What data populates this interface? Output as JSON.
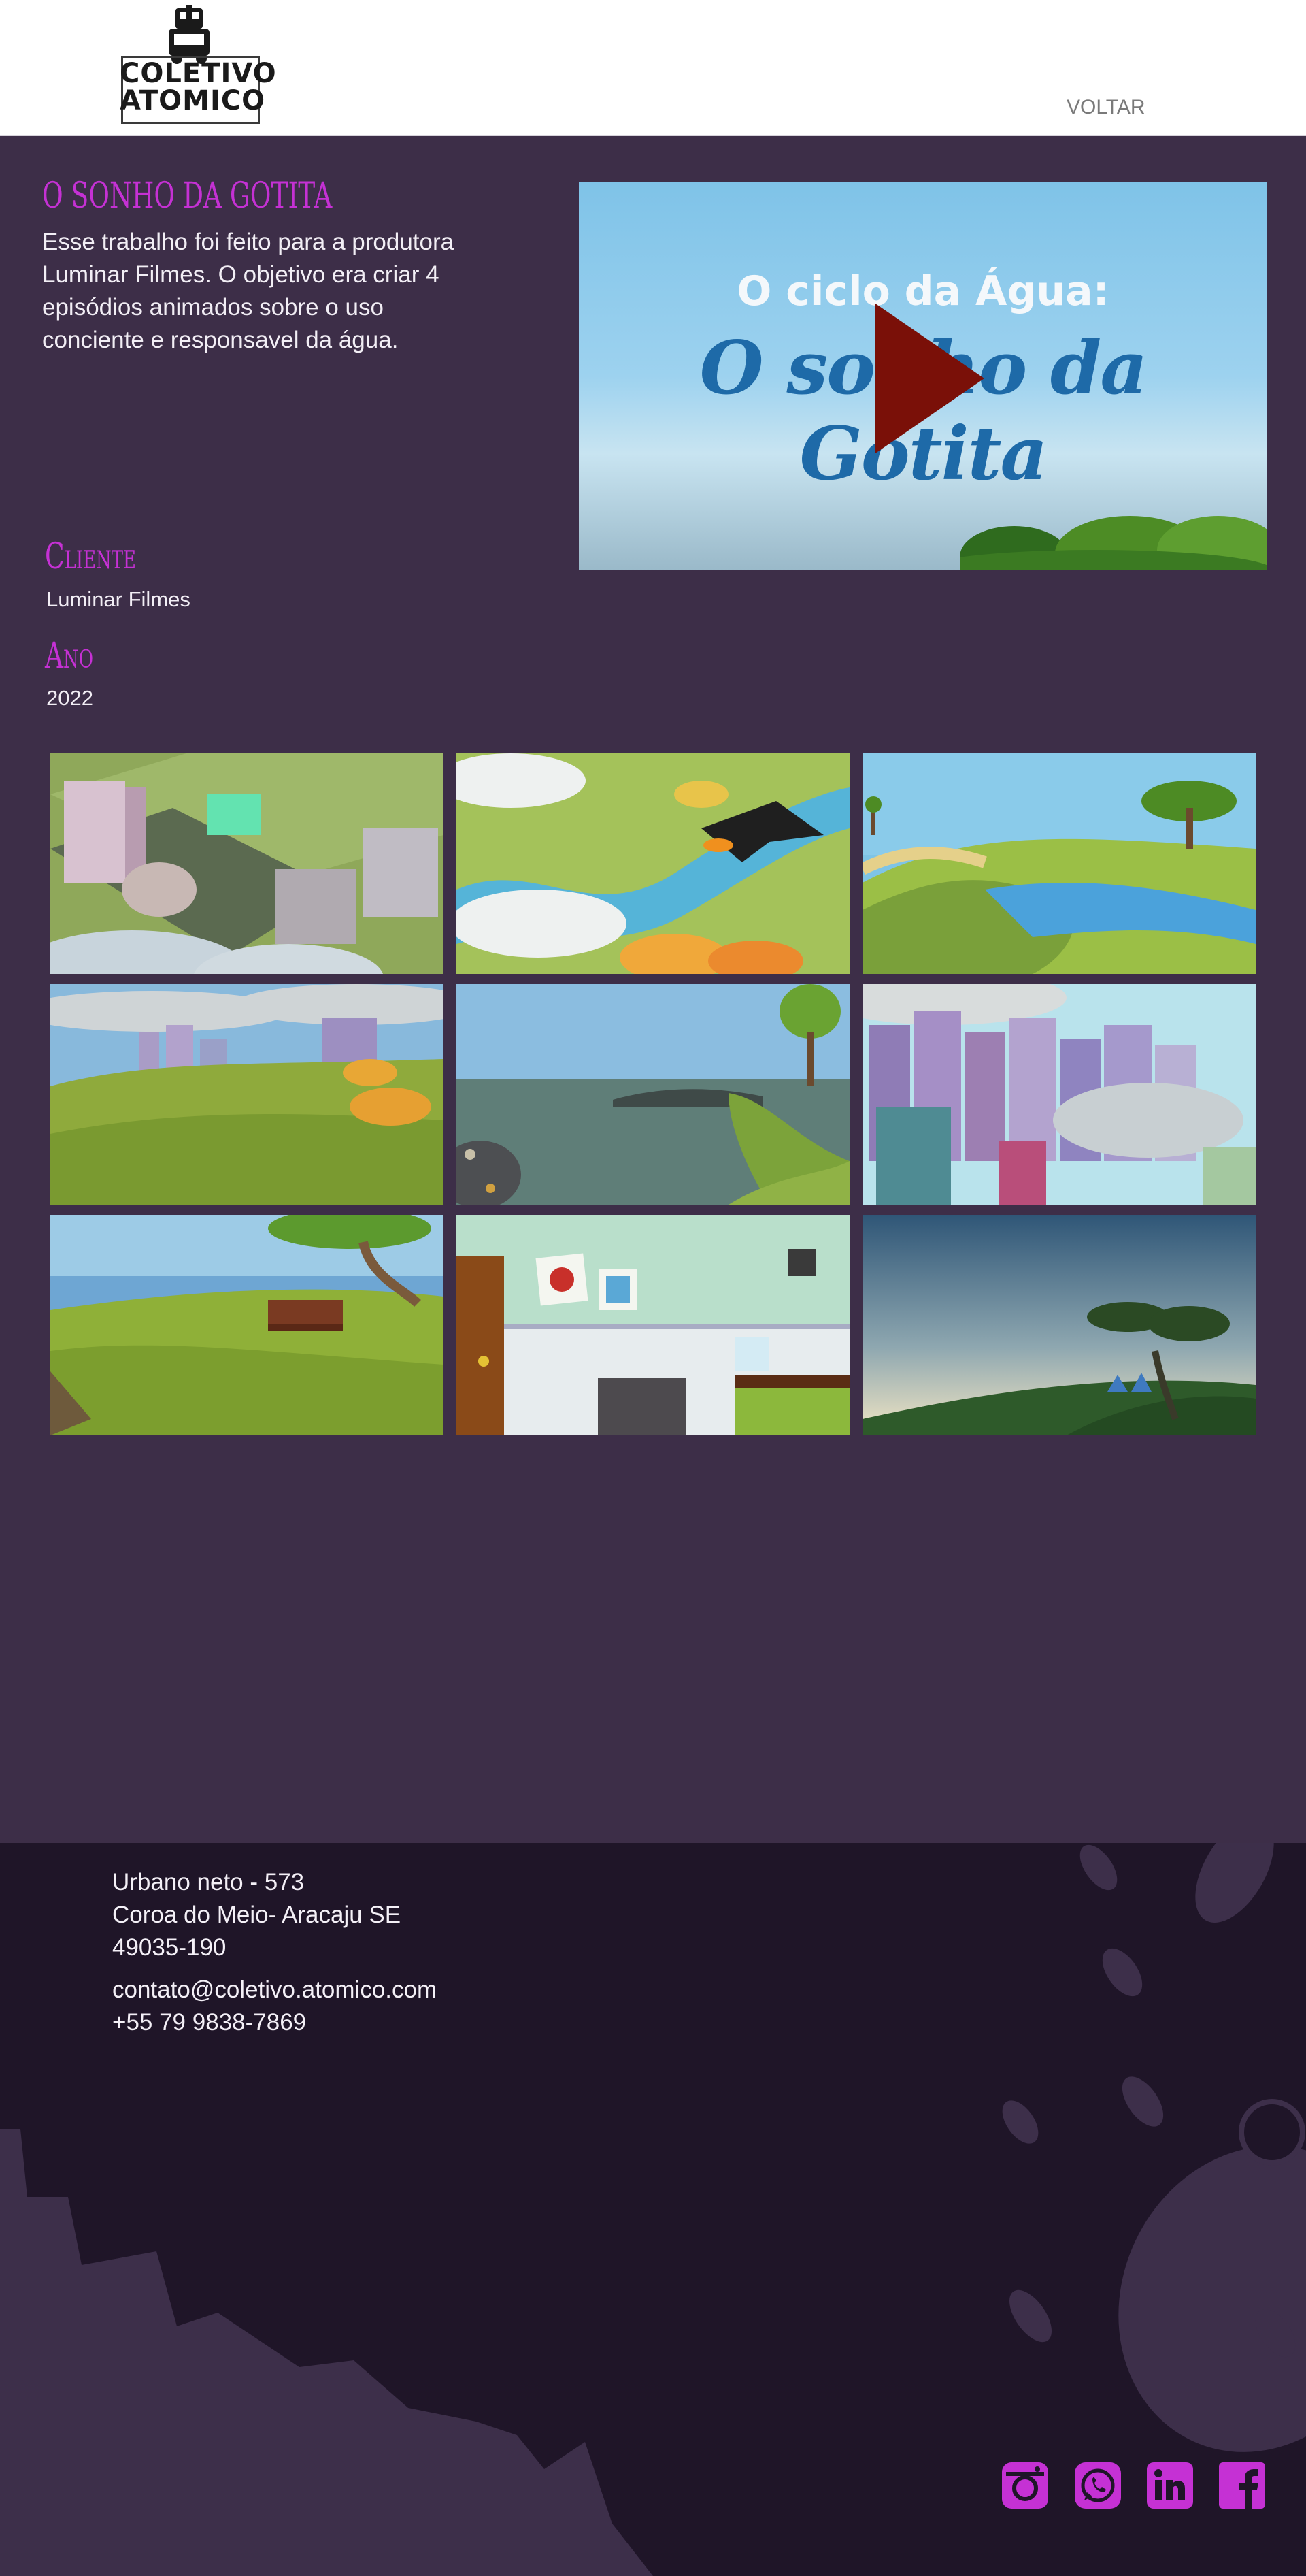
{
  "header": {
    "logo_line1": "COLETIVO",
    "logo_line2": "ATOMICO",
    "back_label": "VOLTAR"
  },
  "project": {
    "title": "O SONHO DA GOTITA",
    "description": "Esse trabalho foi feito para a produtora Luminar Filmes. O objetivo era criar 4 episódios animados sobre o uso conciente e responsavel da água.",
    "client_label": "Cliente",
    "client_value": "Luminar Filmes",
    "year_label": "Ano",
    "year_value": "2022"
  },
  "video": {
    "title_top": "O ciclo da Água:",
    "title_main": "O sonho da Gotita"
  },
  "gallery": {
    "thumbnails": [
      "city-park-aerial-scene",
      "river-toucan-scene",
      "river-valley-scene",
      "city-hill-scene",
      "polluted-lake-scene",
      "city-buildings-scene",
      "park-bench-scene",
      "kitchen-scene",
      "sunset-tree-drops-scene"
    ]
  },
  "footer": {
    "address_line1": "Urbano neto - 573",
    "address_line2": "Coroa do Meio- Aracaju SE",
    "address_line3": "49035-190",
    "email": "contato@coletivo.atomico.com",
    "phone": "+55 79 9838-7869",
    "social": [
      "instagram-icon",
      "whatsapp-icon",
      "linkedin-icon",
      "facebook-icon"
    ]
  },
  "colors": {
    "page_bg": "#3d2e48",
    "footer_bg": "#1f1528",
    "accent": "#c531d4",
    "play": "#7a1008"
  }
}
